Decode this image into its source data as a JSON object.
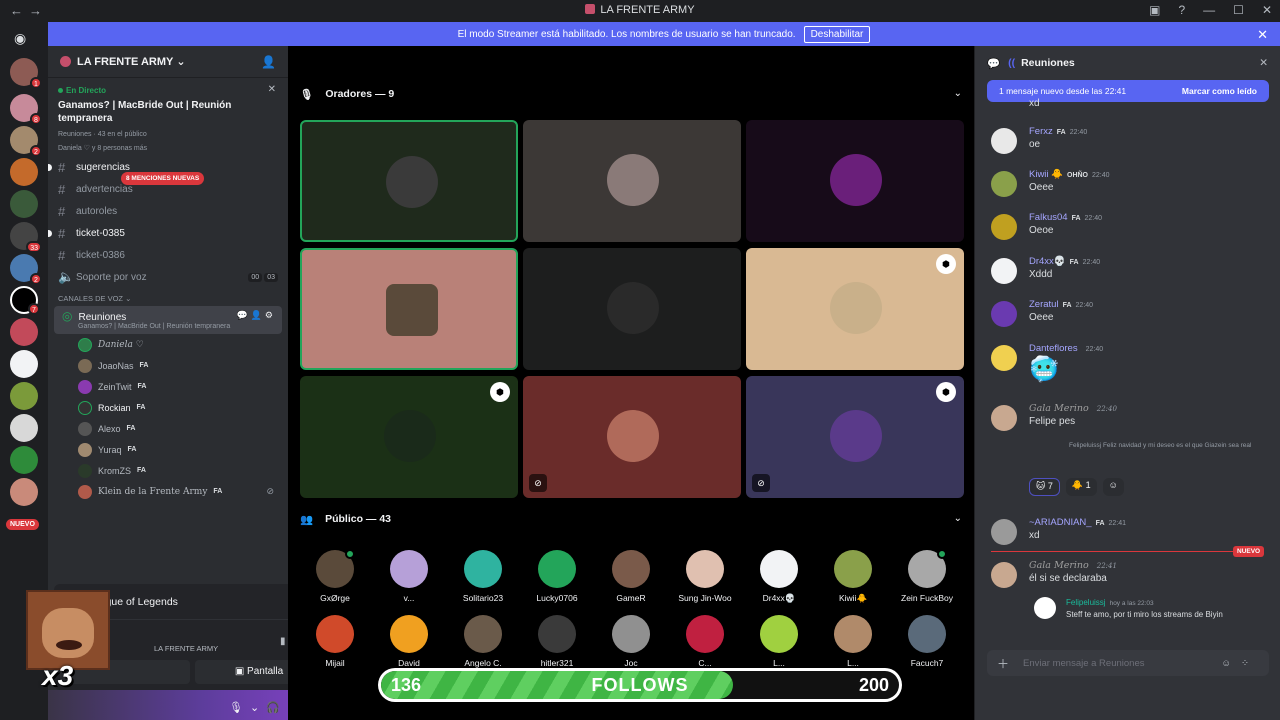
{
  "window": {
    "title": "LA FRENTE ARMY"
  },
  "banner": {
    "text": "El modo Streamer está habilitado. Los nombres de usuario se han truncado.",
    "button": "Deshabilitar"
  },
  "rail": {
    "badges": [
      "1",
      "8",
      "2",
      "33",
      "2",
      "7"
    ],
    "new_label": "NUEVO"
  },
  "server": {
    "name": "LA FRENTE ARMY"
  },
  "event": {
    "live_label": "En Directo",
    "title": "Ganamos? | MacBride Out | Reunión tempranera",
    "meta": "Reuniones · 43 en el público",
    "people": "Daniela ♡ y 8 personas más"
  },
  "channels": [
    {
      "name": "sugerencias",
      "bold": true
    },
    {
      "name": "advertencias",
      "bold": false
    },
    {
      "name": "autoroles",
      "bold": false
    },
    {
      "name": "ticket-0385",
      "bold": true
    },
    {
      "name": "ticket-0386",
      "bold": false
    }
  ],
  "mentions_pill": "8 MENCIONES NUEVAS",
  "voice_support": {
    "name": "Soporte por voz",
    "a": "00",
    "b": "03"
  },
  "voice_category": "CANALES DE VOZ",
  "stage_channel": {
    "name": "Reuniones",
    "subtitle": "Ganamos? | MacBride Out | Reunión tempranera"
  },
  "voice_users": [
    {
      "name": "Daniela ♡",
      "tag": ""
    },
    {
      "name": "JoaoNas",
      "tag": "FA"
    },
    {
      "name": "ZeinTwit",
      "tag": "FA"
    },
    {
      "name": "Rockian",
      "tag": "FA"
    },
    {
      "name": "Alexo",
      "tag": "FA"
    },
    {
      "name": "Yuraq",
      "tag": "FA"
    },
    {
      "name": "KromZS",
      "tag": "FA"
    },
    {
      "name": "Klein de la Frente Army",
      "tag": "FA"
    }
  ],
  "activity": {
    "game": "League of Legends",
    "server": "LA FRENTE ARMY",
    "screen_button": "Pantalla"
  },
  "overlay": {
    "multiplier": "x3"
  },
  "stage": {
    "speakers_label": "Oradores — 9",
    "audience_label": "Público — 43",
    "audience": [
      "GxØrge",
      "v...",
      "Solitario23",
      "Lucky0706",
      "GameR",
      "Sung Jin-Woo",
      "Dr4xx💀",
      "Kiwii🐥",
      "Zein FuckBoy",
      "Mijail",
      "David",
      "Angelo C.",
      "hitler321",
      "Joc",
      "C...",
      "L...",
      "L...",
      "Facuch7"
    ]
  },
  "follows": {
    "current": "136",
    "goal": "200",
    "label": "FOLLOWS",
    "progress": 0.68
  },
  "chat": {
    "channel": "Reuniones",
    "new_bar": "1 mensaje nuevo desde las 22:41",
    "mark_read": "Marcar como leído",
    "first_text": "xd",
    "messages": [
      {
        "name": "Ferxz",
        "tag": "FA",
        "time": "22:40",
        "text": "oe"
      },
      {
        "name": "Kiwii 🐥",
        "tag": "OHÑO",
        "time": "22:40",
        "text": "Oeee"
      },
      {
        "name": "Falkus04",
        "tag": "FA",
        "time": "22:40",
        "text": "Oeoe"
      },
      {
        "name": "Dr4xx💀",
        "tag": "FA",
        "time": "22:40",
        "text": "Xddd"
      },
      {
        "name": "Zeratul",
        "tag": "FA",
        "time": "22:40",
        "text": "Oeee"
      },
      {
        "name": "Danteflores",
        "tag": "",
        "time": "22:40",
        "text": "🥶"
      },
      {
        "name": "Gala Merino",
        "tag": "",
        "time": "22:40",
        "text": "Felipe pes"
      }
    ],
    "reply_quote": "Felipeluissj Feliz navidad y mi deseo es el que Giazein sea real",
    "reactions": [
      "7",
      "1"
    ],
    "late": [
      {
        "name": "~ARIADNIAN_",
        "tag": "FA",
        "time": "22:41",
        "text": "xd"
      },
      {
        "name": "Gala Merino",
        "tag": "",
        "time": "22:41",
        "text": "él si se declaraba"
      }
    ],
    "new_label": "NUEVO",
    "embed": {
      "name": "Felipeluissj",
      "time": "hoy a las 22:03",
      "text": "Steff te amo, por ti miro los streams de Biyin"
    },
    "composer_placeholder": "Enviar mensaje a  Reuniones"
  }
}
